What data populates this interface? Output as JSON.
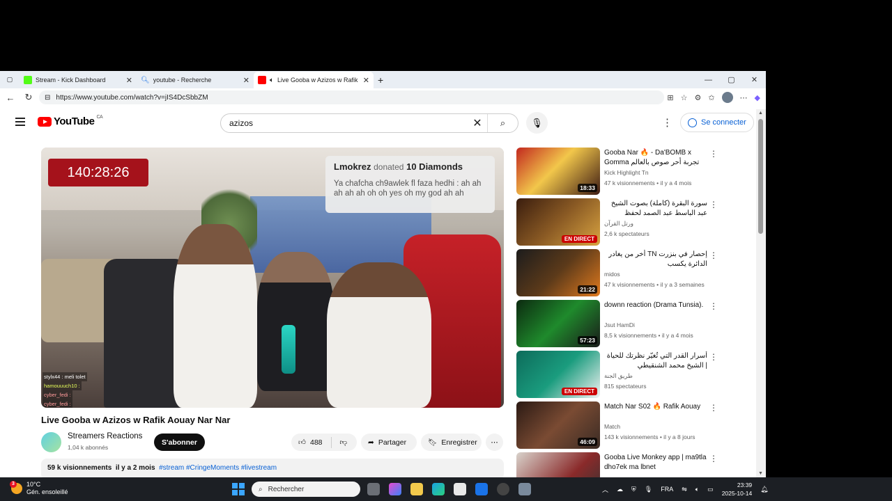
{
  "browser": {
    "tabs": [
      {
        "label": "Stream - Kick Dashboard",
        "favicon": "kick-icon"
      },
      {
        "label": "youtube - Recherche",
        "favicon": "search-icon"
      },
      {
        "label": "Live Gooba w Azizos w Rafik",
        "favicon": "youtube-icon"
      }
    ],
    "url": "https://www.youtube.com/watch?v=jIS4DcSbbZM"
  },
  "header": {
    "logo": "YouTube",
    "region": "CA",
    "search_value": "azizos",
    "signin_label": "Se connecter"
  },
  "player": {
    "timer": "140:28:26",
    "donation": {
      "user": "Lmokrez",
      "donated": "donated",
      "amount": "10 Diamonds",
      "message": "Ya chafcha ch9awlek fl faza hedhi : ah ah ah ah ah oh oh yes oh my god ah ah"
    },
    "chat": [
      {
        "text": "stylx44 : meli tolet"
      },
      {
        "text": "hamouuuch10 :"
      },
      {
        "text": "cyber_fedi :"
      },
      {
        "text": "cyber_fedi :"
      }
    ]
  },
  "video": {
    "title": "Live Gooba w Azizos w Rafik Aouay Nar Nar",
    "channel": "Streamers Reactions",
    "subs": "1,04 k abonnés",
    "subscribe_label": "S'abonner",
    "likes": "488",
    "share_label": "Partager",
    "save_label": "Enregistrer",
    "views": "59 k visionnements",
    "age": "il y a 2 mois",
    "tags": "#stream #CringeMoments #livestream"
  },
  "recommendations": [
    {
      "title": "Gooba Nar 🔥 - Da'BOMB x Gomma تجربة أحر صوص بالعالم على...",
      "channel": "Kick Highlight Tn",
      "meta": "47 k visionnements • il y a 4 mois",
      "badge": "18:33",
      "live": false
    },
    {
      "title": "سورة البقرة (كاملة) بصوت الشيخ عبد الباسط عبد الصمد لحفظ وتحصين المنزل وجلب ...",
      "channel": "ورتل القرآن",
      "meta": "2,6 k spectateurs",
      "badge": "EN DIRECT",
      "live": true
    },
    {
      "title": "إحصار في بنزرت TN أخر من يغادر الدائرة يكسب",
      "channel": "midos",
      "meta": "47 k visionnements • il y a 3 semaines",
      "badge": "21:22",
      "live": false
    },
    {
      "title": "downn reaction (Drama Tunsia).",
      "channel": "Jsut HamDi",
      "meta": "8,5 k visionnements • il y a 4 mois",
      "badge": "57:23",
      "live": false
    },
    {
      "title": "أسرار القدر التي تُغيّر نظرتك للحياة | الشيخ محمد الشنقيطي",
      "channel": "طريق الجنة",
      "meta": "815 spectateurs",
      "badge": "EN DIRECT",
      "live": true
    },
    {
      "title": "Match Nar S02 🔥 Rafik Aouay",
      "channel": "Match",
      "meta": "143 k visionnements • il y a 8 jours",
      "badge": "46:09",
      "live": false
    },
    {
      "title": "Gooba Live Monkey app | ma9tla dho7ek ma lbnet",
      "channel": "",
      "meta": "",
      "badge": "",
      "live": false
    }
  ],
  "taskbar": {
    "weather_temp": "10°C",
    "weather_desc": "Gén. ensoleillé",
    "weather_badge": "3",
    "search_placeholder": "Rechercher",
    "lang": "FRA",
    "time": "23:39",
    "date": "2025-10-14"
  },
  "colors": {
    "accent_blue": "#065fd4",
    "youtube_red": "#ff0000",
    "timer_red": "#a5121b",
    "live_red": "#cc0000"
  }
}
